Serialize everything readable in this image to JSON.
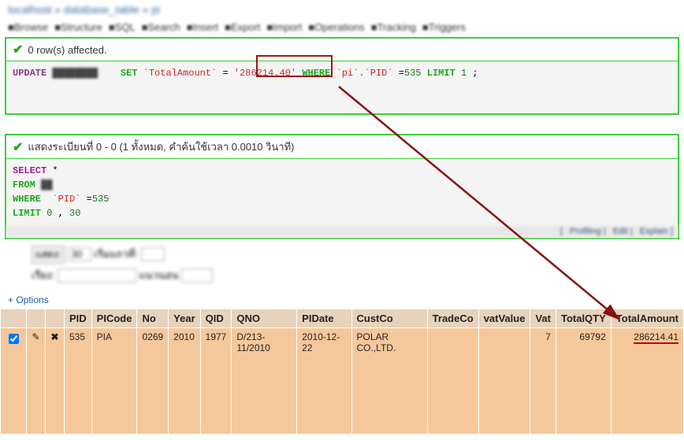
{
  "breadcrumb": "localhost » database_table » pi",
  "toolbar_items": [
    "Browse",
    "Structure",
    "SQL",
    "Search",
    "Insert",
    "Export",
    "Import",
    "Operations",
    "Tracking",
    "Triggers"
  ],
  "panel1": {
    "status": "0 row(s) affected.",
    "sql": {
      "update": "UPDATE",
      "table": "████████",
      "set": "SET",
      "col": "`TotalAmount`",
      "eq": " = ",
      "val": "'286214.40'",
      "where": "WHERE",
      "cond_col": "`pi`.`PID`",
      "cond_op": " =",
      "cond_val": "535",
      "limit": "LIMIT",
      "limit_val": "1",
      "semi": " ;"
    }
  },
  "panel2": {
    "status": "แสดงระเบียนที่ 0 - 0 (1 ทั้งหมด, คำค้นใช้เวลา 0.0010 วินาที)",
    "sql": {
      "select": "SELECT",
      "star": " *",
      "from": "FROM",
      "table": "██",
      "where": "WHERE",
      "col": "`PID`",
      "op": " =",
      "val": "535",
      "limit": "LIMIT",
      "l1": "0",
      "comma": " , ",
      "l2": "30"
    },
    "footer_links": [
      "Profiling",
      "Edit",
      "Explain"
    ]
  },
  "controls": {
    "row1_label": "แสดง:",
    "row1_value": "30",
    "row1_text": "เริ่มแถวที่:",
    "row2_label": "เรียง:",
    "row2_text": "แนวนอน"
  },
  "options_label": "+ Options",
  "table": {
    "headers": [
      "",
      "",
      "",
      "PID",
      "PICode",
      "No",
      "Year",
      "QID",
      "QNO",
      "PIDate",
      "CustCo",
      "TradeCo",
      "vatValue",
      "Vat",
      "TotalQTY",
      "TotalAmount"
    ],
    "row": {
      "checked": true,
      "PID": "535",
      "PICode": "PIA",
      "No": "0269",
      "Year": "2010",
      "QID": "1977",
      "QNO": "D/213-11/2010",
      "PIDate": "2010-12-22",
      "CustCo": "POLAR CO.,LTD.",
      "TradeCo": "",
      "vatValue": "",
      "Vat": "7",
      "TotalQTY": "69792",
      "TotalAmount": "286214.41"
    }
  }
}
